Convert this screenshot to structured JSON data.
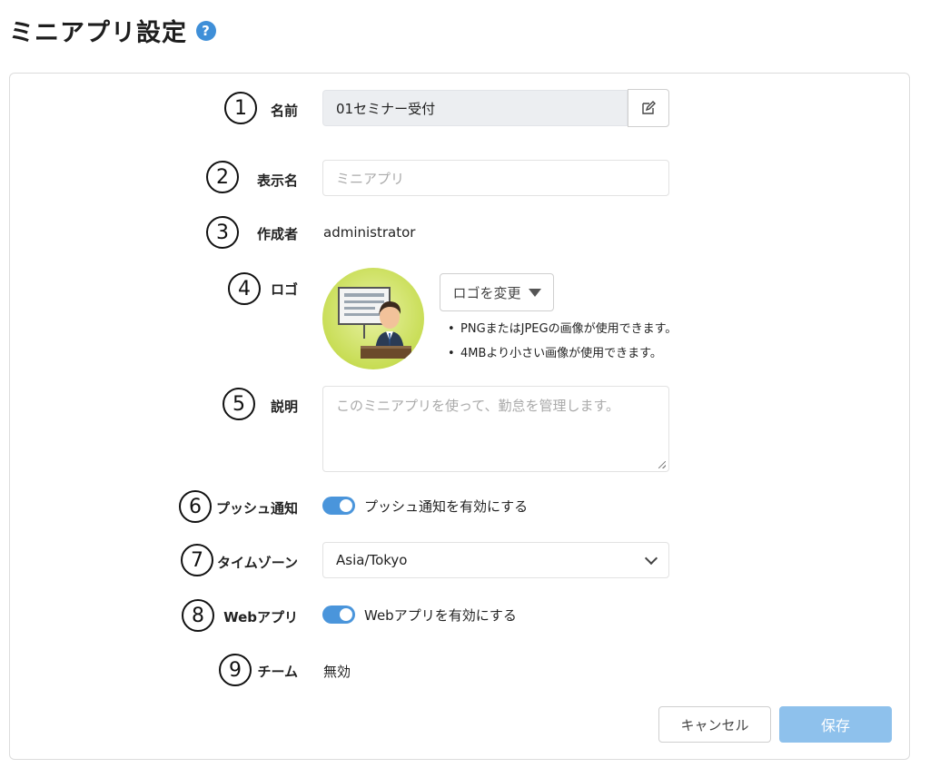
{
  "header": {
    "title": "ミニアプリ設定",
    "help_glyph": "?"
  },
  "form": {
    "name": {
      "number": "1",
      "label": "名前",
      "value": "01セミナー受付"
    },
    "display_name": {
      "number": "2",
      "label": "表示名",
      "placeholder": "ミニアプリ"
    },
    "creator": {
      "number": "3",
      "label": "作成者",
      "value": "administrator"
    },
    "logo": {
      "number": "4",
      "label": "ロゴ",
      "change_label": "ロゴを変更",
      "notes": [
        "PNGまたはJPEGの画像が使用できます。",
        "4MBより小さい画像が使用できます。"
      ]
    },
    "description": {
      "number": "5",
      "label": "説明",
      "placeholder": "このミニアプリを使って、勤怠を管理します。"
    },
    "push": {
      "number": "6",
      "label": "プッシュ通知",
      "toggle_label": "プッシュ通知を有効にする",
      "enabled": true
    },
    "timezone": {
      "number": "7",
      "label": "タイムゾーン",
      "value": "Asia/Tokyo"
    },
    "webapp": {
      "number": "8",
      "label": "Webアプリ",
      "toggle_label": "Webアプリを有効にする",
      "enabled": true
    },
    "team": {
      "number": "9",
      "label": "チーム",
      "value": "無効"
    }
  },
  "actions": {
    "cancel": "キャンセル",
    "save": "保存"
  },
  "colors": {
    "accent": "#4a95db",
    "save_button": "#8ec1ec",
    "logo_bg": "#c8dd55"
  },
  "icons": {
    "edit": "edit-icon",
    "help": "help-icon",
    "logo": "presenter-logo"
  }
}
